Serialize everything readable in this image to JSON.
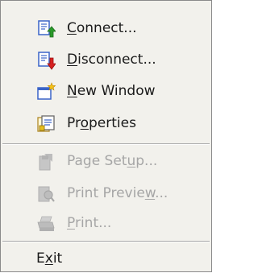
{
  "menu": {
    "items": [
      {
        "pre": "",
        "mn": "C",
        "post": "onnect...",
        "icon": "connect-icon",
        "enabled": true
      },
      {
        "pre": "",
        "mn": "D",
        "post": "isconnect...",
        "icon": "disconnect-icon",
        "enabled": true
      },
      {
        "pre": "",
        "mn": "N",
        "post": "ew Window",
        "icon": "new-window-icon",
        "enabled": true
      },
      {
        "pre": "Pr",
        "mn": "o",
        "post": "perties",
        "icon": "properties-icon",
        "enabled": true
      },
      {
        "pre": "Page Set",
        "mn": "u",
        "post": "p...",
        "icon": "page-setup-icon",
        "enabled": false
      },
      {
        "pre": "Print Previe",
        "mn": "w",
        "post": "...",
        "icon": "print-preview-icon",
        "enabled": false
      },
      {
        "pre": "",
        "mn": "P",
        "post": "rint...",
        "icon": "print-icon",
        "enabled": false
      },
      {
        "pre": "E",
        "mn": "x",
        "post": "it",
        "icon": "",
        "enabled": true
      }
    ]
  },
  "colors": {
    "menu_background": "#f2f1ec",
    "enabled_text": "#1a1a1a",
    "disabled_text": "#a6a6a6",
    "connect_arrow": "#2a9a2a",
    "disconnect_arrow": "#d62020",
    "document_blue": "#3a64c8",
    "new_window_star": "#f4c21a"
  }
}
